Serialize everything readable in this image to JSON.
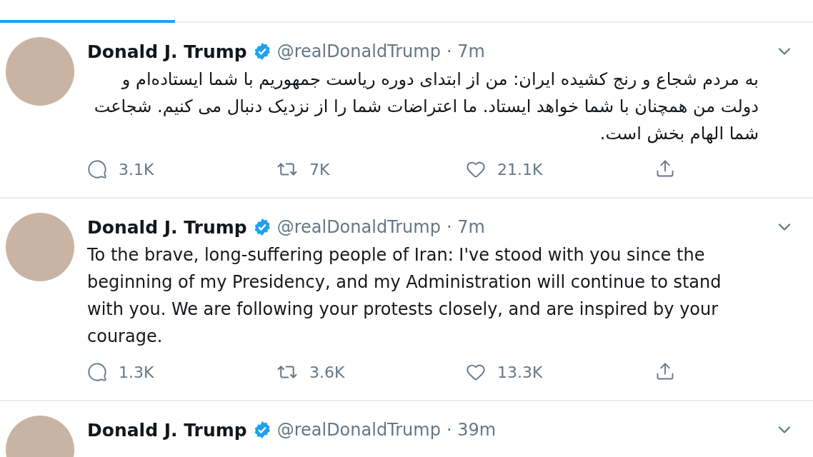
{
  "tweets": [
    {
      "name": "Donald J. Trump",
      "verified": true,
      "handle": "@realDonaldTrump",
      "time": "· 7m",
      "text": "به مردم شجاع و رنج کشیده ایران: من از ابتدای دوره ریاست جمهوریم با شما ایستاده‌ام و دولت من همچنان با شما خواهد ایستاد. ما اعتراضات شما را از نزدیک دنبال می کنیم. شجاعت شما الهام بخش است.",
      "replies": "3.1K",
      "retweets": "7K",
      "likes": "21.1K"
    },
    {
      "name": "Donald J. Trump",
      "verified": true,
      "handle": "@realDonaldTrump",
      "time": "· 7m",
      "text": "To the brave, long-suffering people of Iran: I've stood with you since the beginning of my Presidency, and my Administration will continue to stand with you. We are following your protests closely, and are inspired by your courage.",
      "replies": "1.3K",
      "retweets": "3.6K",
      "likes": "13.3K"
    },
    {
      "name": "Donald J. Trump",
      "verified": true,
      "handle": "@realDonaldTrump",
      "time": "· 39m"
    }
  ]
}
